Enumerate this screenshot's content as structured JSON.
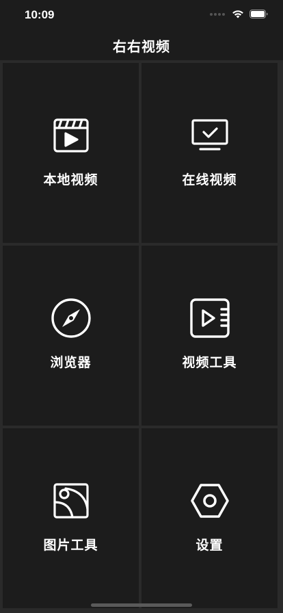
{
  "status_bar": {
    "time": "10:09",
    "icons": [
      "signal-dots-icon",
      "wifi-icon",
      "battery-icon"
    ]
  },
  "nav": {
    "title": "右右视频"
  },
  "tiles": [
    {
      "label": "本地视频",
      "icon": "clapperboard-icon"
    },
    {
      "label": "在线视频",
      "icon": "monitor-check-icon"
    },
    {
      "label": "浏览器",
      "icon": "compass-icon"
    },
    {
      "label": "视频工具",
      "icon": "video-play-icon"
    },
    {
      "label": "图片工具",
      "icon": "image-icon"
    },
    {
      "label": "设置",
      "icon": "hexagon-settings-icon"
    }
  ],
  "colors": {
    "background": "#2a2a2a",
    "tile": "#1c1c1c",
    "text": "#ffffff"
  }
}
